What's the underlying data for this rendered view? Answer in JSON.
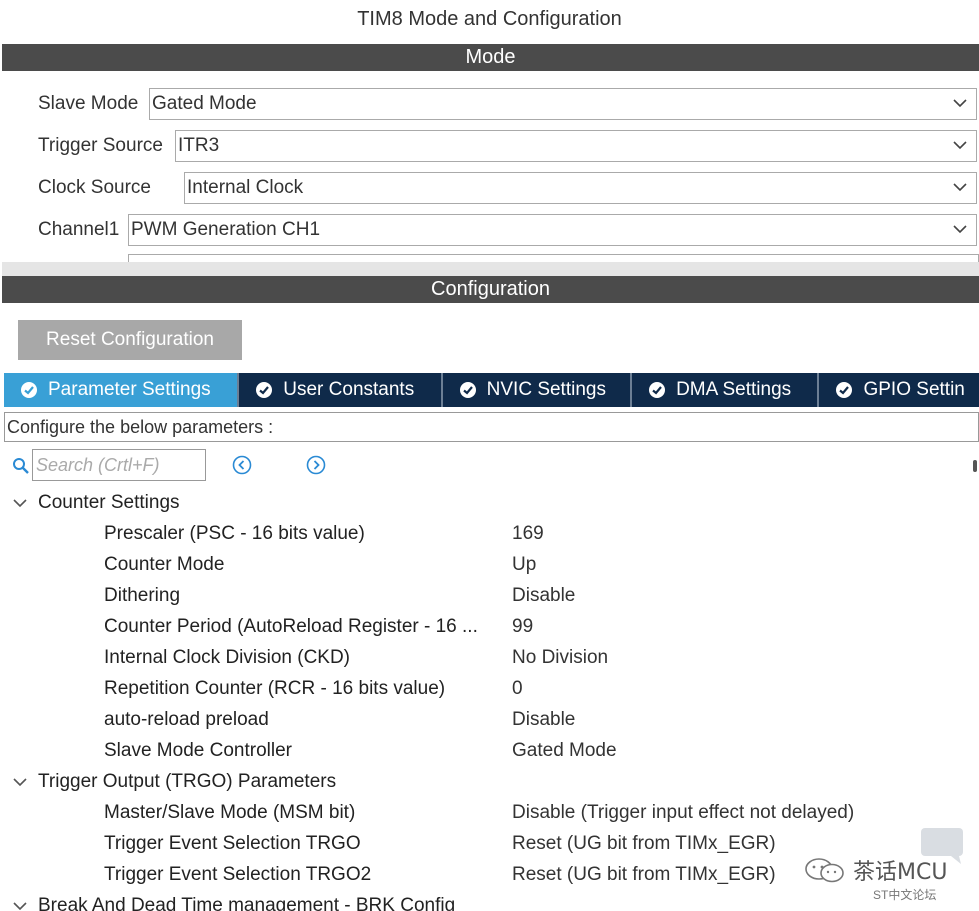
{
  "window": {
    "title": "TIM8 Mode and Configuration"
  },
  "mode": {
    "header": "Mode",
    "fields": [
      {
        "label": "Slave Mode",
        "value": "Gated Mode"
      },
      {
        "label": "Trigger Source",
        "value": "ITR3"
      },
      {
        "label": "Clock Source",
        "value": "Internal Clock"
      },
      {
        "label": "Channel1",
        "value": "PWM Generation CH1"
      }
    ]
  },
  "configuration": {
    "header": "Configuration",
    "reset_label": "Reset Configuration",
    "tabs": [
      {
        "label": "Parameter Settings",
        "active": true
      },
      {
        "label": "User Constants",
        "active": false
      },
      {
        "label": "NVIC Settings",
        "active": false
      },
      {
        "label": "DMA Settings",
        "active": false
      },
      {
        "label": "GPIO Settin",
        "active": false
      }
    ],
    "description": "Configure the below parameters :",
    "search_placeholder": "Search (Crtl+F)",
    "groups": [
      {
        "name": "Counter Settings",
        "params": [
          {
            "name": "Prescaler (PSC - 16 bits value)",
            "value": "169"
          },
          {
            "name": "Counter Mode",
            "value": "Up"
          },
          {
            "name": "Dithering",
            "value": "Disable"
          },
          {
            "name": "Counter Period (AutoReload Register - 16 ...",
            "value": "99"
          },
          {
            "name": "Internal Clock Division (CKD)",
            "value": "No Division"
          },
          {
            "name": "Repetition Counter (RCR - 16 bits value)",
            "value": "0"
          },
          {
            "name": "auto-reload preload",
            "value": "Disable"
          },
          {
            "name": "Slave Mode Controller",
            "value": "Gated Mode"
          }
        ]
      },
      {
        "name": "Trigger Output (TRGO) Parameters",
        "params": [
          {
            "name": "Master/Slave Mode (MSM bit)",
            "value": "Disable (Trigger input effect not delayed)"
          },
          {
            "name": "Trigger Event Selection TRGO",
            "value": "Reset (UG bit from TIMx_EGR)"
          },
          {
            "name": "Trigger Event Selection TRGO2",
            "value": "Reset (UG bit from TIMx_EGR)"
          }
        ]
      },
      {
        "name": "Break And Dead Time management - BRK Config",
        "params": []
      }
    ]
  },
  "watermark": {
    "text": "茶话MCU",
    "sub": "ST中文论坛"
  },
  "colors": {
    "section_bar": "#4b4b4b",
    "tab_active": "#39a0d6",
    "tab_bg": "#0f2a4a",
    "reset_button": "#a8a8a8"
  },
  "icons": [
    "chevron-down-icon",
    "check-circle-icon",
    "search-icon",
    "nav-left-icon",
    "nav-right-icon",
    "caret-down-icon"
  ]
}
